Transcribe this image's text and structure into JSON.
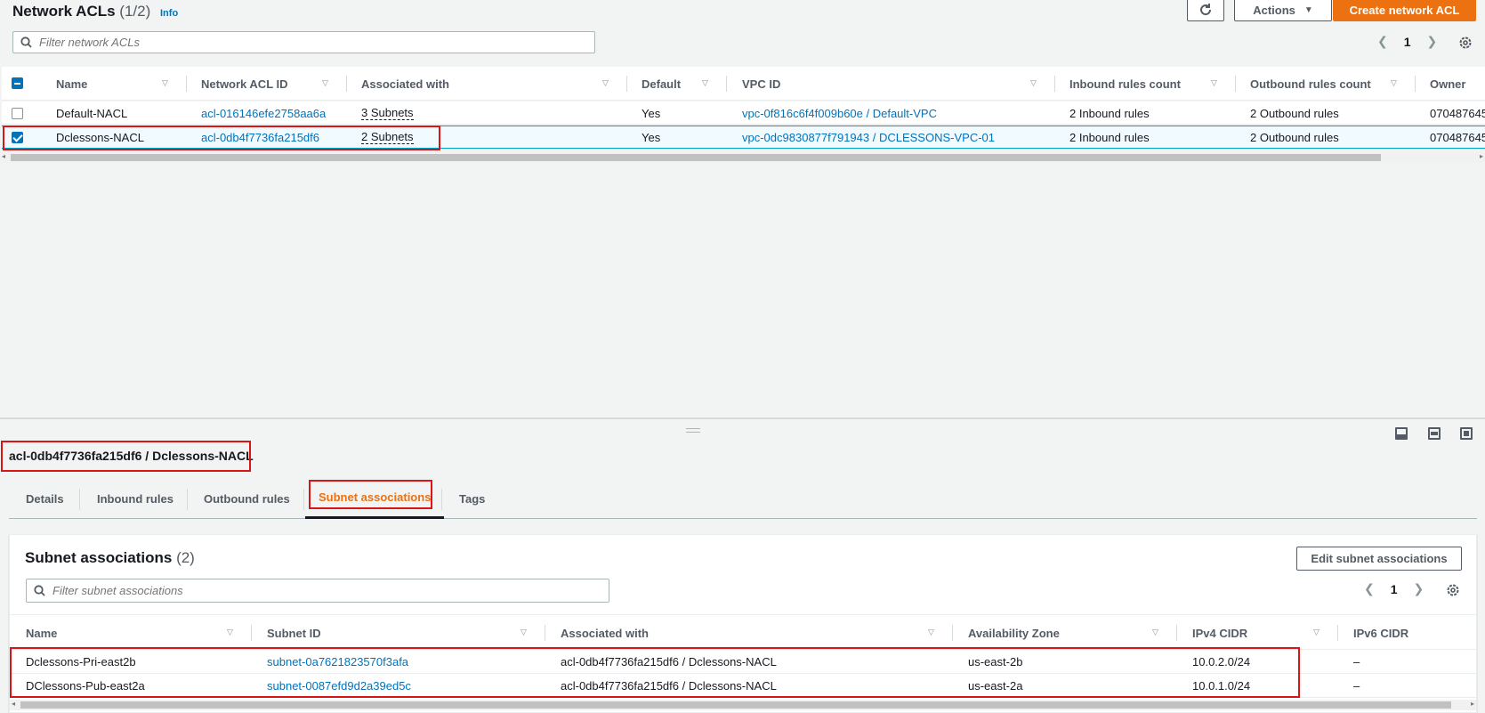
{
  "header": {
    "title": "Network ACLs",
    "count": "(1/2)",
    "info": "Info",
    "actions_label": "Actions",
    "create_label": "Create network ACL",
    "search_placeholder": "Filter network ACLs",
    "page": "1"
  },
  "acl_table": {
    "columns": [
      "Name",
      "Network ACL ID",
      "Associated with",
      "Default",
      "VPC ID",
      "Inbound rules count",
      "Outbound rules count",
      "Owner"
    ],
    "rows": [
      {
        "name": "Default-NACL",
        "id": "acl-016146efe2758aa6a",
        "assoc": "3 Subnets",
        "default": "Yes",
        "vpc": "vpc-0f816c6f4f009b60e / Default-VPC",
        "inbound": "2 Inbound rules",
        "outbound": "2 Outbound rules",
        "owner": "070487645",
        "selected": false
      },
      {
        "name": "Dclessons-NACL",
        "id": "acl-0db4f7736fa215df6",
        "assoc": "2 Subnets",
        "default": "Yes",
        "vpc": "vpc-0dc9830877f791943 / DCLESSONS-VPC-01",
        "inbound": "2 Inbound rules",
        "outbound": "2 Outbound rules",
        "owner": "070487645",
        "selected": true
      }
    ]
  },
  "details": {
    "title": "acl-0db4f7736fa215df6 / Dclessons-NACL",
    "tabs": [
      "Details",
      "Inbound rules",
      "Outbound rules",
      "Subnet associations",
      "Tags"
    ],
    "active_tab": "Subnet associations"
  },
  "subnets": {
    "title": "Subnet associations",
    "count": "(2)",
    "edit_label": "Edit subnet associations",
    "search_placeholder": "Filter subnet associations",
    "page": "1",
    "columns": [
      "Name",
      "Subnet ID",
      "Associated with",
      "Availability Zone",
      "IPv4 CIDR",
      "IPv6 CIDR"
    ],
    "rows": [
      {
        "name": "Dclessons-Pri-east2b",
        "subnet": "subnet-0a7621823570f3afa",
        "assoc": "acl-0db4f7736fa215df6 / Dclessons-NACL",
        "az": "us-east-2b",
        "ipv4": "10.0.2.0/24",
        "ipv6": "–"
      },
      {
        "name": "DClessons-Pub-east2a",
        "subnet": "subnet-0087efd9d2a39ed5c",
        "assoc": "acl-0db4f7736fa215df6 / Dclessons-NACL",
        "az": "us-east-2a",
        "ipv4": "10.0.1.0/24",
        "ipv6": "–"
      }
    ]
  },
  "colors": {
    "accent": "#ec7211",
    "link": "#0073bb",
    "highlight": "#d91515"
  }
}
